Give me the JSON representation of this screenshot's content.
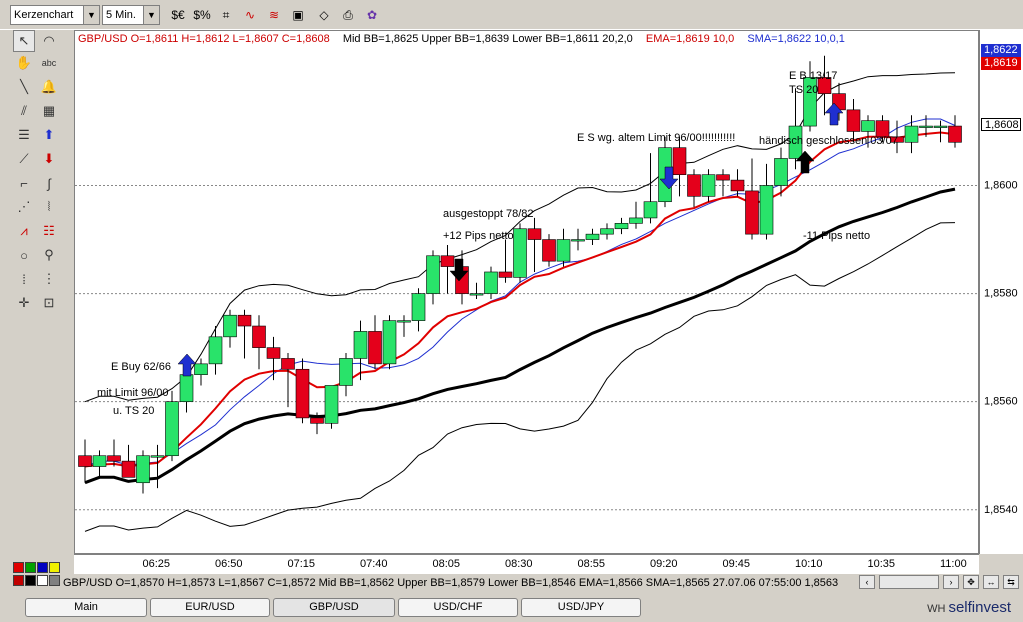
{
  "toolbar": {
    "chart_type": "Kerzenchart",
    "interval": "5 Min."
  },
  "chart_info": {
    "symbol_ohlc": "GBP/USD O=1,8611 H=1,8612 L=1,8607 C=1,8608",
    "bollinger": "Mid BB=1,8625 Upper BB=1,8639 Lower BB=1,8611 20,2,0",
    "ema": "EMA=1,8619 10,0",
    "sma": "SMA=1,8622 10,0,1"
  },
  "price_tags": {
    "upper": "1,8622",
    "ema": "1,8619",
    "current": "1,8608"
  },
  "status_bar": "GBP/USD O=1,8570 H=1,8573 L=1,8567 C=1,8572  Mid BB=1,8562 Upper BB=1,8579 Lower BB=1,8546 EMA=1,8566 SMA=1,8565  27.07.06 07:55:00 1,8563",
  "tabs": [
    "Main",
    "EUR/USD",
    "GBP/USD",
    "USD/CHF",
    "USD/JPY"
  ],
  "brand": {
    "prefix": "WH",
    "name": "selfinvest"
  },
  "annotations": {
    "buy1": "E Buy 62/66",
    "buy2": "mit Limit 96/00",
    "buy3": "u. TS 20",
    "stop1": "ausgestoppt 78/82",
    "stop2": "+12 Pips netto",
    "sell": "E S wg. altem Limit 96/00!!!!!!!!!!!",
    "eb1": "E B 13/17",
    "eb2": "TS 20",
    "manual": "händisch geschlossen 03/07",
    "loss": "-11 Pips netto"
  },
  "colors": {
    "bull": "#29e36a",
    "bear": "#e4001b",
    "ema": "#e00000",
    "sma": "#1f2fd0",
    "bb": "#000000"
  },
  "chart_data": {
    "type": "candlestick",
    "x": [
      "06:00",
      "06:05",
      "06:10",
      "06:15",
      "06:20",
      "06:25",
      "06:30",
      "06:35",
      "06:40",
      "06:45",
      "06:50",
      "06:55",
      "07:00",
      "07:05",
      "07:10",
      "07:15",
      "07:20",
      "07:25",
      "07:30",
      "07:35",
      "07:40",
      "07:45",
      "07:50",
      "07:55",
      "08:00",
      "08:05",
      "08:10",
      "08:15",
      "08:20",
      "08:25",
      "08:30",
      "08:35",
      "08:40",
      "08:45",
      "08:50",
      "08:55",
      "09:00",
      "09:05",
      "09:10",
      "09:15",
      "09:20",
      "09:25",
      "09:30",
      "09:35",
      "09:40",
      "09:45",
      "09:50",
      "09:55",
      "10:00",
      "10:05",
      "10:10",
      "10:15",
      "10:20",
      "10:25",
      "10:30",
      "10:35",
      "10:40",
      "10:45",
      "10:50",
      "10:55",
      "11:00"
    ],
    "open": [
      1.855,
      1.8548,
      1.855,
      1.8549,
      1.8545,
      1.855,
      1.855,
      1.856,
      1.8565,
      1.8567,
      1.8572,
      1.8576,
      1.8574,
      1.857,
      1.8568,
      1.8566,
      1.8557,
      1.8556,
      1.8563,
      1.8568,
      1.8573,
      1.8567,
      1.8575,
      1.8575,
      1.858,
      1.8587,
      1.8585,
      1.858,
      1.858,
      1.8584,
      1.8583,
      1.8592,
      1.859,
      1.8586,
      1.859,
      1.859,
      1.8591,
      1.8592,
      1.8593,
      1.8594,
      1.8597,
      1.8607,
      1.8602,
      1.8598,
      1.8602,
      1.8601,
      1.8599,
      1.8591,
      1.86,
      1.8605,
      1.8611,
      1.862,
      1.8617,
      1.8614,
      1.861,
      1.8612,
      1.8609,
      1.8608,
      1.8611,
      1.8611,
      1.8611
    ],
    "high": [
      1.8553,
      1.8551,
      1.8553,
      1.8552,
      1.8551,
      1.8552,
      1.8562,
      1.8566,
      1.8568,
      1.8574,
      1.8577,
      1.8577,
      1.8576,
      1.8572,
      1.8569,
      1.8568,
      1.8558,
      1.8562,
      1.8569,
      1.8575,
      1.8576,
      1.8576,
      1.8576,
      1.8581,
      1.8588,
      1.8589,
      1.8588,
      1.8582,
      1.8585,
      1.859,
      1.8593,
      1.8594,
      1.8591,
      1.8592,
      1.8592,
      1.8592,
      1.8593,
      1.8594,
      1.8597,
      1.8606,
      1.8609,
      1.8609,
      1.8603,
      1.8603,
      1.8603,
      1.8603,
      1.8605,
      1.8604,
      1.8607,
      1.8618,
      1.8623,
      1.8624,
      1.8619,
      1.8616,
      1.8613,
      1.8613,
      1.8612,
      1.8613,
      1.8613,
      1.8612,
      1.8613
    ],
    "low": [
      1.8545,
      1.8546,
      1.8548,
      1.8546,
      1.8543,
      1.8544,
      1.8549,
      1.8558,
      1.8563,
      1.8565,
      1.857,
      1.8568,
      1.8566,
      1.8564,
      1.8559,
      1.8556,
      1.8554,
      1.8555,
      1.8561,
      1.8564,
      1.8566,
      1.8566,
      1.8572,
      1.8573,
      1.8578,
      1.858,
      1.8578,
      1.8579,
      1.8579,
      1.8582,
      1.8582,
      1.8584,
      1.8585,
      1.8585,
      1.8588,
      1.8589,
      1.859,
      1.8591,
      1.8592,
      1.8593,
      1.8596,
      1.8598,
      1.8596,
      1.8597,
      1.8598,
      1.8598,
      1.859,
      1.859,
      1.8598,
      1.8603,
      1.861,
      1.8613,
      1.8612,
      1.8608,
      1.8607,
      1.8608,
      1.8606,
      1.8606,
      1.8609,
      1.8608,
      1.8607
    ],
    "close": [
      1.8548,
      1.855,
      1.8549,
      1.8546,
      1.855,
      1.855,
      1.856,
      1.8565,
      1.8567,
      1.8572,
      1.8576,
      1.8574,
      1.857,
      1.8568,
      1.8566,
      1.8557,
      1.8556,
      1.8563,
      1.8568,
      1.8573,
      1.8567,
      1.8575,
      1.8575,
      1.858,
      1.8587,
      1.8585,
      1.858,
      1.858,
      1.8584,
      1.8583,
      1.8592,
      1.859,
      1.8586,
      1.859,
      1.859,
      1.8591,
      1.8592,
      1.8593,
      1.8594,
      1.8597,
      1.8607,
      1.8602,
      1.8598,
      1.8602,
      1.8601,
      1.8599,
      1.8591,
      1.86,
      1.8605,
      1.8611,
      1.862,
      1.8617,
      1.8614,
      1.861,
      1.8612,
      1.8609,
      1.8608,
      1.8611,
      1.8611,
      1.8611,
      1.8608
    ],
    "ylim": [
      1.8532,
      1.8626
    ],
    "yticks": [
      "1,8540",
      "1,8560",
      "1,8580",
      "1,8600"
    ],
    "yticks_values": [
      1.854,
      1.856,
      1.858,
      1.86
    ],
    "xticks": [
      "06:25",
      "06:50",
      "07:15",
      "07:40",
      "08:05",
      "08:30",
      "08:55",
      "09:20",
      "09:45",
      "10:10",
      "10:35",
      "11:00"
    ],
    "grid": "horizontal dashed"
  }
}
